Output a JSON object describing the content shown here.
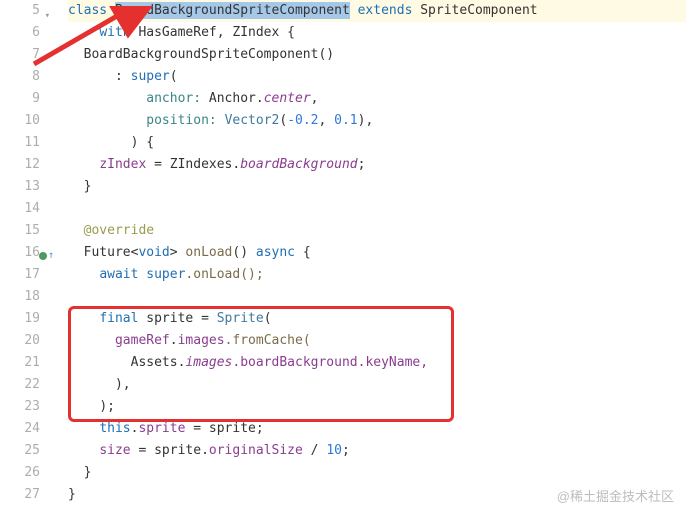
{
  "watermark": "@稀土掘金技术社区",
  "gutter": {
    "start": 5,
    "end": 27,
    "override_line": 16
  },
  "code": {
    "l5": {
      "class_kw": "class ",
      "class_name": "BoardBackgroundSpriteComponent",
      "extends_kw": " extends ",
      "super_type": "SpriteComponent"
    },
    "l6": {
      "with_kw": "with ",
      "mixins": "HasGameRef, ZIndex {"
    },
    "l7": {
      "ctor": "BoardBackgroundSpriteComponent()"
    },
    "l8": {
      "colon": ": ",
      "super_kw": "super",
      "open": "("
    },
    "l9": {
      "param": "anchor: ",
      "val": "Anchor.",
      "member": "center",
      "comma": ","
    },
    "l10": {
      "param": "position: ",
      "call": "Vector2",
      "open": "(",
      "n1": "-0.2",
      "c": ", ",
      "n2": "0.1",
      "close": "),"
    },
    "l11": {
      "close": ") {"
    },
    "l12": {
      "lhs": "zIndex",
      "eq": " = ",
      "cls": "ZIndexes.",
      "member": "boardBackground",
      "semi": ";"
    },
    "l13": {
      "brace": "}"
    },
    "l14": {
      "blank": ""
    },
    "l15": {
      "annotation": "@override"
    },
    "l16": {
      "ret": "Future<",
      "void_kw": "void",
      "gt": "> ",
      "name": "onLoad",
      "parens": "() ",
      "async_kw": "async",
      "brace": " {"
    },
    "l17": {
      "await_kw": "await ",
      "super_kw": "super",
      "call": ".onLoad();"
    },
    "l18": {
      "blank": ""
    },
    "l19": {
      "final_kw": "final ",
      "var": "sprite = ",
      "call": "Sprite",
      "open": "("
    },
    "l20": {
      "ref": "gameRef",
      "dot": ".",
      "images": "images",
      "from": ".fromCache("
    },
    "l21": {
      "assets": "Assets.",
      "images_it": "images",
      "rest": ".boardBackground.keyName,"
    },
    "l22": {
      "close": "),"
    },
    "l23": {
      "close": ");"
    },
    "l24": {
      "this_kw": "this",
      "dot": ".",
      "lhs": "sprite",
      "eq": " = sprite;"
    },
    "l25": {
      "lhs": "size",
      "eq": " = sprite.",
      "member": "originalSize",
      "rest": " / ",
      "num": "10",
      "semi": ";"
    },
    "l26": {
      "brace": "}"
    },
    "l27": {
      "brace": "}"
    }
  }
}
